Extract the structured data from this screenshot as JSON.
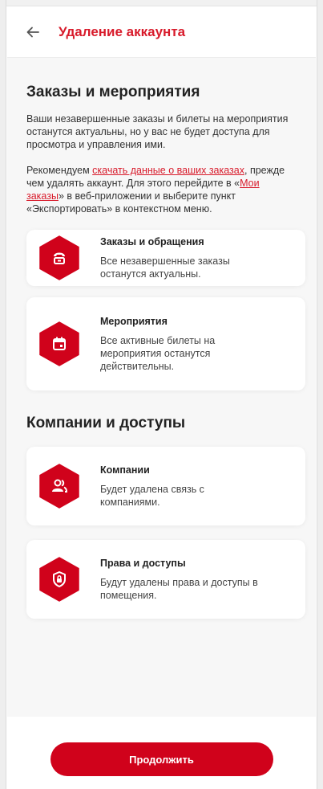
{
  "header": {
    "title": "Удаление аккаунта",
    "back_icon": "arrow-left-icon"
  },
  "section_orders": {
    "title": "Заказы и мероприятия",
    "paragraph1": "Ваши незавершенные заказы и билеты на мероприятия останутся актуальны, но у вас не будет доступа для просмотра и управления ими.",
    "paragraph2_prefix": "Рекомендуем ",
    "paragraph2_link1": "скачать данные о ваших заказах",
    "paragraph2_middle": ", прежде чем удалять аккаунт. Для этого перейдите в «",
    "paragraph2_link2": "Мои заказы",
    "paragraph2_suffix": "» в веб-приложении и выберите пункт «Экспортировать» в контекстном меню.",
    "cards": [
      {
        "title": "Заказы и обращения",
        "desc": "Все незавершенные заказы останутся актуальны.",
        "icon": "service-desk-icon"
      },
      {
        "title": "Мероприятия",
        "desc": "Все активные билеты на мероприятия останутся действительны.",
        "icon": "calendar-icon"
      }
    ]
  },
  "section_companies": {
    "title": "Компании и доступы",
    "cards": [
      {
        "title": "Компании",
        "desc": "Будет удалена связь с компаниями.",
        "icon": "people-icon"
      },
      {
        "title": "Права и доступы",
        "desc": "Будут удалены права и доступы в помещения.",
        "icon": "security-lock-icon"
      }
    ]
  },
  "footer": {
    "continue_label": "Продолжить"
  },
  "colors": {
    "accent": "#d0021b",
    "background": "#f7f7f7"
  }
}
